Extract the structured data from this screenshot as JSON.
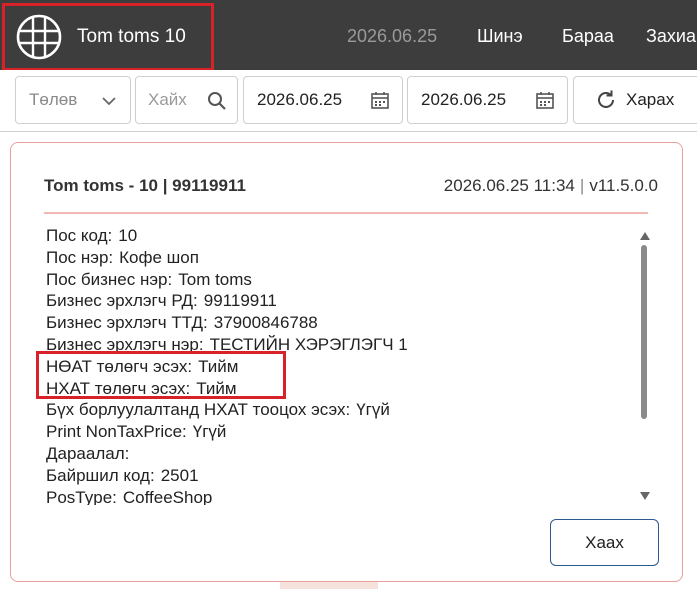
{
  "header": {
    "brand": "Tom toms 10",
    "date": "2026.06.25",
    "nav": [
      "Шинэ",
      "Бараа",
      "Захиа"
    ]
  },
  "toolbar": {
    "payment_select": "Төлөв",
    "search_placeholder": "Хайх",
    "date_from": "2026.06.25",
    "date_to": "2026.06.25",
    "refresh_label": "Харах"
  },
  "modal": {
    "title": "Tom toms - 10 | 99119911",
    "datetime": "2026.06.25 11:34",
    "version": "v11.5.0.0",
    "rows": [
      {
        "label": "Пос код:",
        "value": "10"
      },
      {
        "label": "Пос нэр:",
        "value": "Кофе шоп"
      },
      {
        "label": "Пос бизнес нэр:",
        "value": "Tom toms"
      },
      {
        "label": "Бизнес эрхлэгч РД:",
        "value": "99119911"
      },
      {
        "label": "Бизнес эрхлэгч ТТД:",
        "value": "37900846788"
      },
      {
        "label": "Бизнес эрхлэгч нэр:",
        "value": "ТЕСТИЙН ХЭРЭГЛЭГЧ 1"
      },
      {
        "label": "НӨАТ төлөгч эсэх:",
        "value": "Тийм"
      },
      {
        "label": "НХАТ төлөгч эсэх:",
        "value": "Тийм"
      },
      {
        "label": "Бүх борлуулалтанд НХАТ тооцох эсэх:",
        "value": "Үгүй"
      },
      {
        "label": "Print NonTaxPrice:",
        "value": "Үгүй"
      },
      {
        "label": "Дараалал:",
        "value": ""
      },
      {
        "label": "Байршил код:",
        "value": "2501"
      },
      {
        "label": "PosType:",
        "value": "CoffeeShop"
      }
    ],
    "close_label": "Хаах"
  },
  "colors": {
    "topbar": "#3d3d3d",
    "highlight": "#d8222a",
    "modal_border": "#e8a09c",
    "button_border": "#2d5a8e"
  },
  "icons": [
    "globe-logo-icon",
    "chevron-down-icon",
    "search-icon",
    "calendar-icon",
    "refresh-icon",
    "scroll-up-icon",
    "scroll-down-icon"
  ]
}
